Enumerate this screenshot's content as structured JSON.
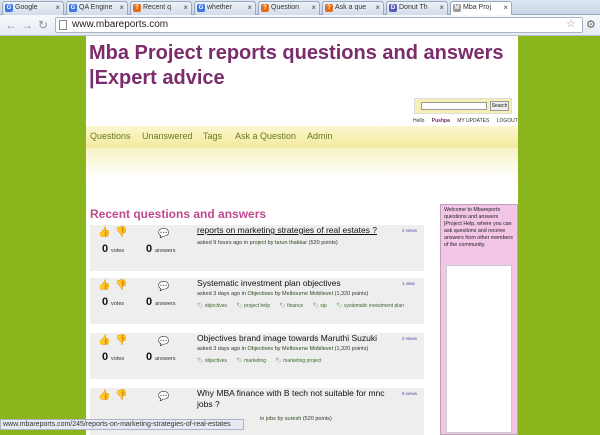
{
  "browser": {
    "tabs": [
      {
        "label": "Google",
        "fav": "G",
        "color": "#3b78e7"
      },
      {
        "label": "QA Engine",
        "fav": "G",
        "color": "#3b78e7"
      },
      {
        "label": "Recent q",
        "fav": "?",
        "color": "#e07020"
      },
      {
        "label": "whether",
        "fav": "G",
        "color": "#3b78e7"
      },
      {
        "label": "Question",
        "fav": "?",
        "color": "#e07020"
      },
      {
        "label": "Ask a que",
        "fav": "?",
        "color": "#e07020"
      },
      {
        "label": "Donut Th",
        "fav": "D",
        "color": "#5a5ab8"
      },
      {
        "label": "Mba Proj",
        "fav": "M",
        "color": "#9a9a9a"
      }
    ],
    "url": "www.mbareports.com",
    "status_url": "www.mbareports.com/245/reports-on-marketing-strategies-of-real-estates"
  },
  "site": {
    "title": "Mba Project reports questions and answers |Expert advice",
    "search_button": "Search",
    "user_prefix": "Hello",
    "user_name": "Pushpa",
    "my_updates": "MY UPDATES",
    "logout": "LOGOUT",
    "nav": [
      "Questions",
      "Unanswered",
      "Tags",
      "Ask a Question",
      "Admin"
    ],
    "section_heading": "Recent questions and answers",
    "sidebar_text": "Welcome to Mbareports questions and answers |Project Help, where you can ask questions and receive answers from other members of the community."
  },
  "questions": [
    {
      "title": "reports on marketing strategies of real estates ?",
      "votes": "0",
      "votes_label": "votes",
      "answers": "0",
      "answers_label": "answers",
      "asked": "asked",
      "when": "9 hours ago",
      "in": "in",
      "category": "project",
      "by": "by",
      "user": "tarun thakkar",
      "points": "(520 points)",
      "views": "2 views",
      "tags": []
    },
    {
      "title": "Systematic investment plan objectives",
      "votes": "0",
      "votes_label": "votes",
      "answers": "0",
      "answers_label": "answers",
      "asked": "asked",
      "when": "3 days ago",
      "in": "in",
      "category": "Objectives",
      "by": "by",
      "user": "Melbourne Mobilevet",
      "points": "(1,320 points)",
      "views": "1 view",
      "tags": [
        "objectives",
        "project help",
        "finance",
        "sip",
        "systematic investment plan"
      ]
    },
    {
      "title": "Objectives brand image towards Maruthi Suzuki",
      "votes": "0",
      "votes_label": "votes",
      "answers": "0",
      "answers_label": "answers",
      "asked": "asked",
      "when": "3 days ago",
      "in": "in",
      "category": "Objectives",
      "by": "by",
      "user": "Melbourne Mobilevet",
      "points": "(1,320 points)",
      "views": "2 views",
      "tags": [
        "objectives",
        "marketing",
        "marketing project"
      ]
    },
    {
      "title": "Why MBA finance with B tech not suitable for mnc jobs ?",
      "votes": "0",
      "votes_label": "votes",
      "answers": "0",
      "answers_label": "answers",
      "asked": "asked",
      "when": "",
      "in": "in",
      "category": "jobs",
      "by": "by",
      "user": "suresh",
      "points": "(520 points)",
      "views": "5 views",
      "tags": []
    }
  ]
}
